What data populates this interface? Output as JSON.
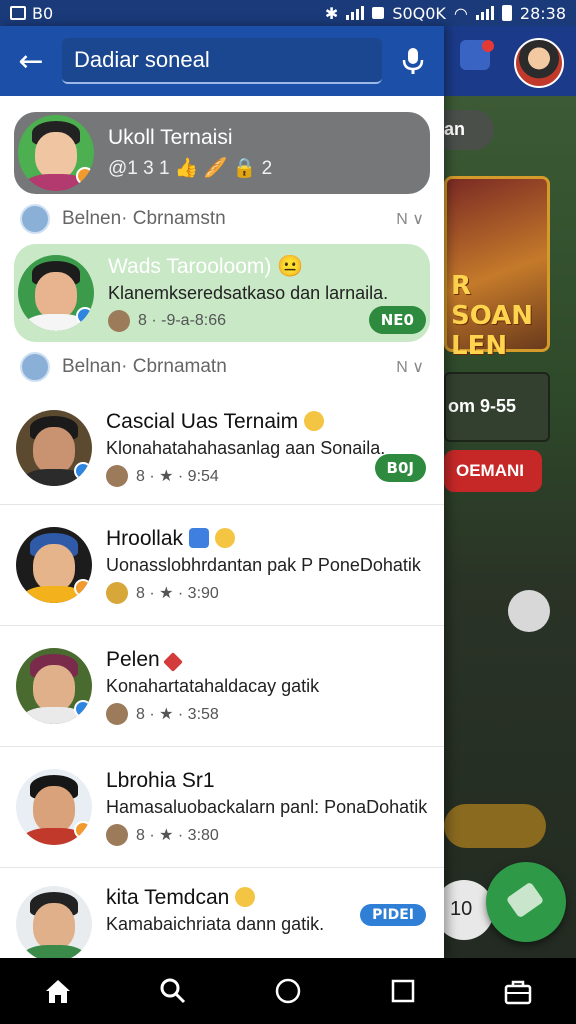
{
  "status_bar": {
    "left_text": "B0",
    "network_text": "S0Q0K",
    "time": "28:38"
  },
  "top_bar": {
    "search_value": "Dadiar soneal",
    "back_icon": "arrow-left-icon",
    "mic_icon": "microphone-icon"
  },
  "rows": [
    {
      "kind": "card-gray",
      "name": "Ukoll Ternaisi",
      "meta": "@1 3  1  👍  🥖  🔒 2"
    },
    {
      "kind": "section",
      "label": "Belnen· Cbrnamstn",
      "right": "N ∨"
    },
    {
      "kind": "card-green",
      "name": "Wads Tarooloom) 😐",
      "snippet": "Klanemkseredsatkaso dan larnaila.",
      "meta": "8 · -9-a-8:66",
      "tag": "NE0"
    },
    {
      "kind": "section",
      "label": "Belnan· Cbrnamatn",
      "right": "N ∨"
    },
    {
      "kind": "plain",
      "name": "Cascial Uas Ternaim",
      "snippet": "Klonahatahahasanlag aan Sonaila.",
      "meta": "8 · ★ · 9:54",
      "tag": "B0J",
      "tag_color": "green"
    },
    {
      "kind": "plain",
      "name": "Hroollak",
      "snippet": "Uonasslobhrdantan pak P PoneDohatik",
      "meta": "8 · ★ · 3:90"
    },
    {
      "kind": "plain",
      "name": "Pelen",
      "snippet": "Konahartatahaldacay gatik",
      "meta": "8 · ★ · 3:58"
    },
    {
      "kind": "plain",
      "name": "Lbrohia Sr1",
      "snippet": "Hamasaluobackalarn panl: PonaDohatik",
      "meta": "8 · ★ · 3:80"
    },
    {
      "kind": "plain",
      "name": "kita Temdcan",
      "snippet": "Kamabaichriata dann gatik.",
      "meta": "",
      "tag": "PIDEI",
      "tag_color": "blue"
    }
  ],
  "background_app": {
    "pill_text": "an",
    "banner_text": "R SOAN LEN",
    "card_text": "om 9-55",
    "red_button": "OEMANI",
    "number": "10"
  },
  "nav_bar": {
    "items": [
      "home-icon",
      "search-icon",
      "circle-home-icon",
      "square-recents-icon",
      "bag-icon"
    ]
  },
  "colors": {
    "header_blue": "#1c4fa8",
    "card_gray": "#757779",
    "card_green": "#c8e8c6",
    "tag_green": "#2e8a3e",
    "fab_green": "#2e9a48"
  }
}
